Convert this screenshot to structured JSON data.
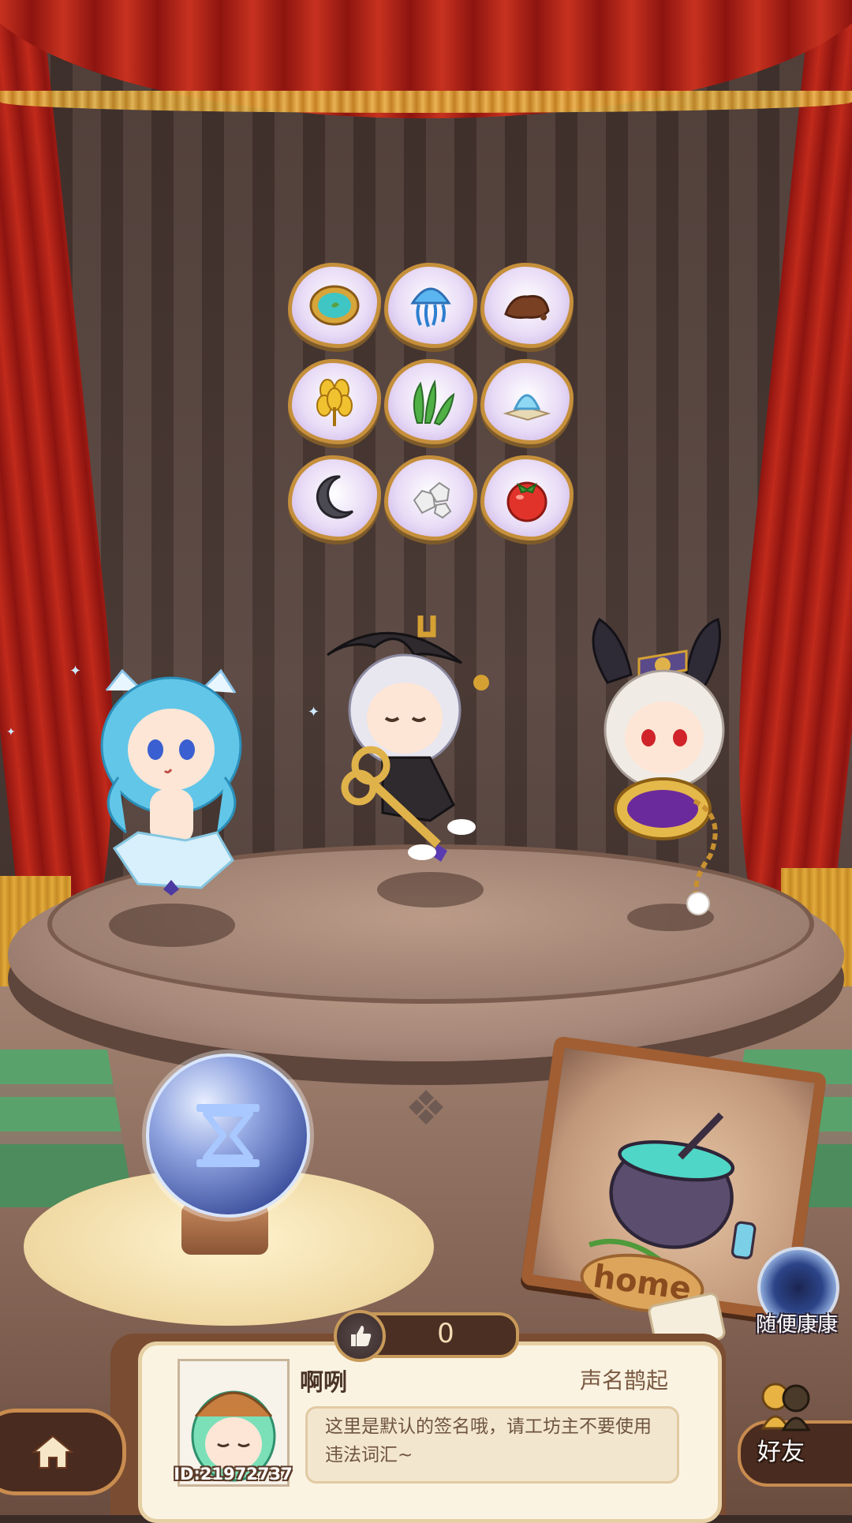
{
  "ingredients": [
    {
      "name": "mirror-ingredient-icon"
    },
    {
      "name": "jellyfish-ingredient-icon"
    },
    {
      "name": "dirt-ingredient-icon"
    },
    {
      "name": "golden-wheat-ingredient-icon"
    },
    {
      "name": "green-herb-ingredient-icon"
    },
    {
      "name": "ice-crystal-ingredient-icon"
    },
    {
      "name": "moon-stone-ingredient-icon"
    },
    {
      "name": "rock-ingredient-icon"
    },
    {
      "name": "tomato-ingredient-icon"
    }
  ],
  "characters": [
    "ice-fairy-character",
    "key-witch-character",
    "bunny-mirror-character"
  ],
  "hourglass": {
    "icon": "hourglass-icon"
  },
  "home_frame": {
    "label": "home"
  },
  "portal": {
    "label": "随便康康",
    "icon": "portal-icon"
  },
  "likes": {
    "count": "0",
    "icon": "thumbs-up-icon"
  },
  "profile": {
    "name": "啊咧",
    "title": "声名鹊起",
    "id": "ID:21972737",
    "signature": "这里是默认的签名哦，请工坊主不要使用违法词汇~"
  },
  "nav": {
    "home_icon": "home-icon",
    "friends_label": "好友",
    "friends_icon": "friends-icon"
  },
  "colors": {
    "curtain": "#c02a1b",
    "fringe": "#e2ab3c",
    "card": "#fbf3e2",
    "accent": "#c98c4f"
  }
}
